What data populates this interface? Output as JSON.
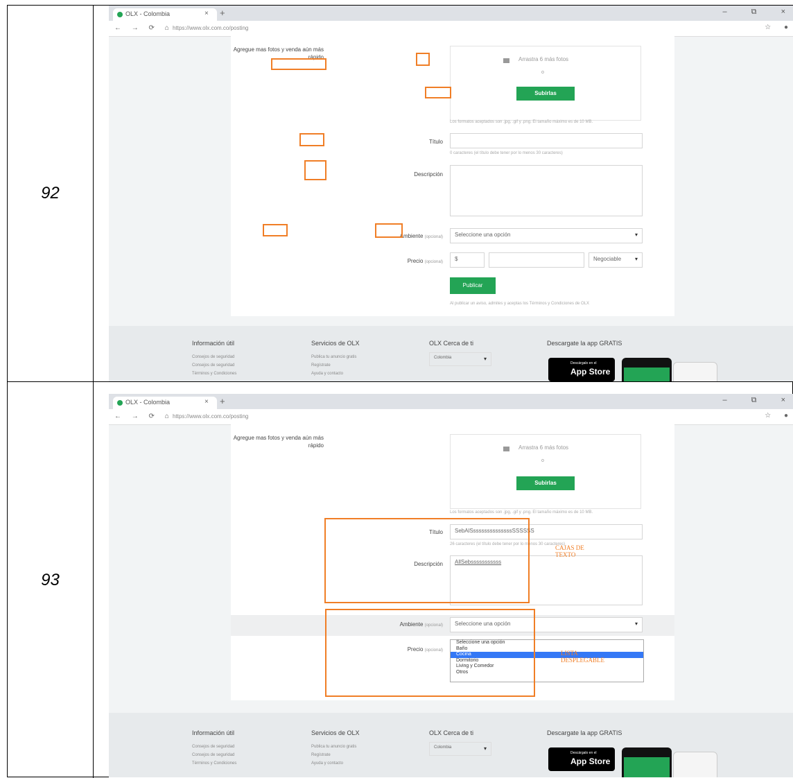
{
  "rows": [
    {
      "number": "92",
      "browser": {
        "tab_title": "OLX - Colombia",
        "url": "https://www.olx.com.co/posting"
      },
      "form": {
        "photos_label": "Agregue mas fotos y venda aún más rápido",
        "upload_text": "Arrastra 6 más fotos",
        "upload_or": "o",
        "upload_button": "Subirlas",
        "upload_hint": "Los formatos aceptados son .jpg, .gif y .png. El tamaño máximo es de 10 MB.",
        "title_label": "Título",
        "title_value": "",
        "title_hint": "0 caracteres (el título debe tener por lo menos 30 caracteres)",
        "description_label": "Descripción",
        "description_value": "",
        "ambiente_label": "Ambiente",
        "ambiente_optional": "(opcional)",
        "ambiente_select": "Seleccione una opción",
        "precio_label": "Precio",
        "precio_optional": "(opcional)",
        "currency": "$",
        "negotiable": "Negociable",
        "publish_button": "Publicar",
        "terms": "Al publicar un aviso, admites y aceptas los Términos y Condiciones de OLX"
      },
      "footer": {
        "col1_title": "Información útil",
        "col1_items": [
          "Consejos de seguridad",
          "Consejos de seguridad",
          "Términos y Condiciones"
        ],
        "col2_title": "Servicios de OLX",
        "col2_items": [
          "Publica tu anuncio gratis",
          "Regístrate",
          "Ayuda y contacto"
        ],
        "col3_title": "OLX Cerca de ti",
        "col3_select": "Colombia",
        "col4_title": "Descargate la app GRATIS",
        "appstore_small": "Descárgalo en el",
        "appstore_label": "App Store"
      }
    },
    {
      "number": "93",
      "browser": {
        "tab_title": "OLX - Colombia",
        "url": "https://www.olx.com.co/posting"
      },
      "form": {
        "photos_label": "Agregue mas fotos y venda aún más rápido",
        "upload_text": "Arrastra 6 más fotos",
        "upload_or": "o",
        "upload_button": "Subirlas",
        "upload_hint": "Los formatos aceptados son .jpg, .gif y .png. El tamaño máximo es de 10 MB.",
        "title_label": "Título",
        "title_value": "SebAlSssssssssssssssSSSSSS",
        "title_hint": "26 caracteres (el título debe tener por lo menos 30 caracteres)",
        "description_label": "Descripción",
        "description_value": "AllSebsssssssssss",
        "ambiente_label": "Ambiente",
        "ambiente_optional": "(opcional)",
        "ambiente_select": "Seleccione una opción",
        "precio_label": "Precio",
        "precio_optional": "(opcional)",
        "dropdown_options": [
          "Seleccione una opción",
          "Baño",
          "Cocina",
          "Dormitorio",
          "Living y Comedor",
          "Otros"
        ],
        "dropdown_selected_index": 2,
        "annotation_text_boxes": "CAJAS DE TEXTO",
        "annotation_dropdown": "LISTA DESPLEGABLE"
      },
      "footer": {
        "col1_title": "Información útil",
        "col1_items": [
          "Consejos de seguridad",
          "Consejos de seguridad",
          "Términos y Condiciones"
        ],
        "col2_title": "Servicios de OLX",
        "col2_items": [
          "Publica tu anuncio gratis",
          "Regístrate",
          "Ayuda y contacto"
        ],
        "col3_title": "OLX Cerca de ti",
        "col3_select": "Colombia",
        "col4_title": "Descargate la app GRATIS",
        "appstore_small": "Descárgalo en el",
        "appstore_label": "App Store"
      }
    }
  ],
  "colors": {
    "accent_green": "#23a455",
    "highlight_orange": "#f07e26",
    "selected_blue": "#3478f6"
  }
}
